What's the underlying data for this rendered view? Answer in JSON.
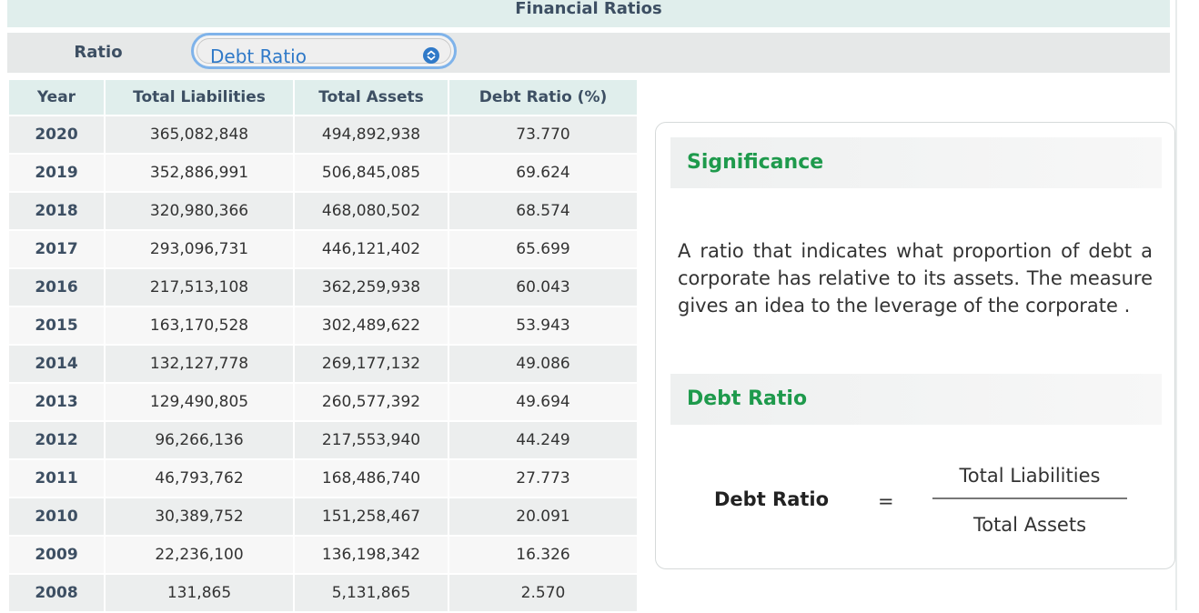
{
  "title": "Financial Ratios",
  "ratio_selector": {
    "label": "Ratio",
    "selected": "Debt Ratio"
  },
  "table": {
    "headers": [
      "Year",
      "Total Liabilities",
      "Total Assets",
      "Debt Ratio (%)"
    ],
    "rows": [
      [
        "2020",
        "365,082,848",
        "494,892,938",
        "73.770"
      ],
      [
        "2019",
        "352,886,991",
        "506,845,085",
        "69.624"
      ],
      [
        "2018",
        "320,980,366",
        "468,080,502",
        "68.574"
      ],
      [
        "2017",
        "293,096,731",
        "446,121,402",
        "65.699"
      ],
      [
        "2016",
        "217,513,108",
        "362,259,938",
        "60.043"
      ],
      [
        "2015",
        "163,170,528",
        "302,489,622",
        "53.943"
      ],
      [
        "2014",
        "132,127,778",
        "269,177,132",
        "49.086"
      ],
      [
        "2013",
        "129,490,805",
        "260,577,392",
        "49.694"
      ],
      [
        "2012",
        "96,266,136",
        "217,553,940",
        "44.249"
      ],
      [
        "2011",
        "46,793,762",
        "168,486,740",
        "27.773"
      ],
      [
        "2010",
        "30,389,752",
        "151,258,467",
        "20.091"
      ],
      [
        "2009",
        "22,236,100",
        "136,198,342",
        "16.326"
      ],
      [
        "2008",
        "131,865",
        "5,131,865",
        "2.570"
      ]
    ]
  },
  "panel": {
    "significance_heading": "Significance",
    "significance_text": "A ratio that indicates what proportion of debt a corporate has relative to its assets. The measure gives an idea to the leverage of the corporate .",
    "formula_heading": "Debt Ratio",
    "formula": {
      "label": "Debt Ratio",
      "equals": "=",
      "numerator": "Total Liabilities",
      "denominator": "Total Assets"
    }
  },
  "colors": {
    "accent_green": "#1e9a4c",
    "header_text": "#3d4f63",
    "select_text": "#2f79c8",
    "select_focus_ring": "#7fb3ea"
  },
  "icons": {
    "select_chevron": "chevron-up-down-icon"
  }
}
